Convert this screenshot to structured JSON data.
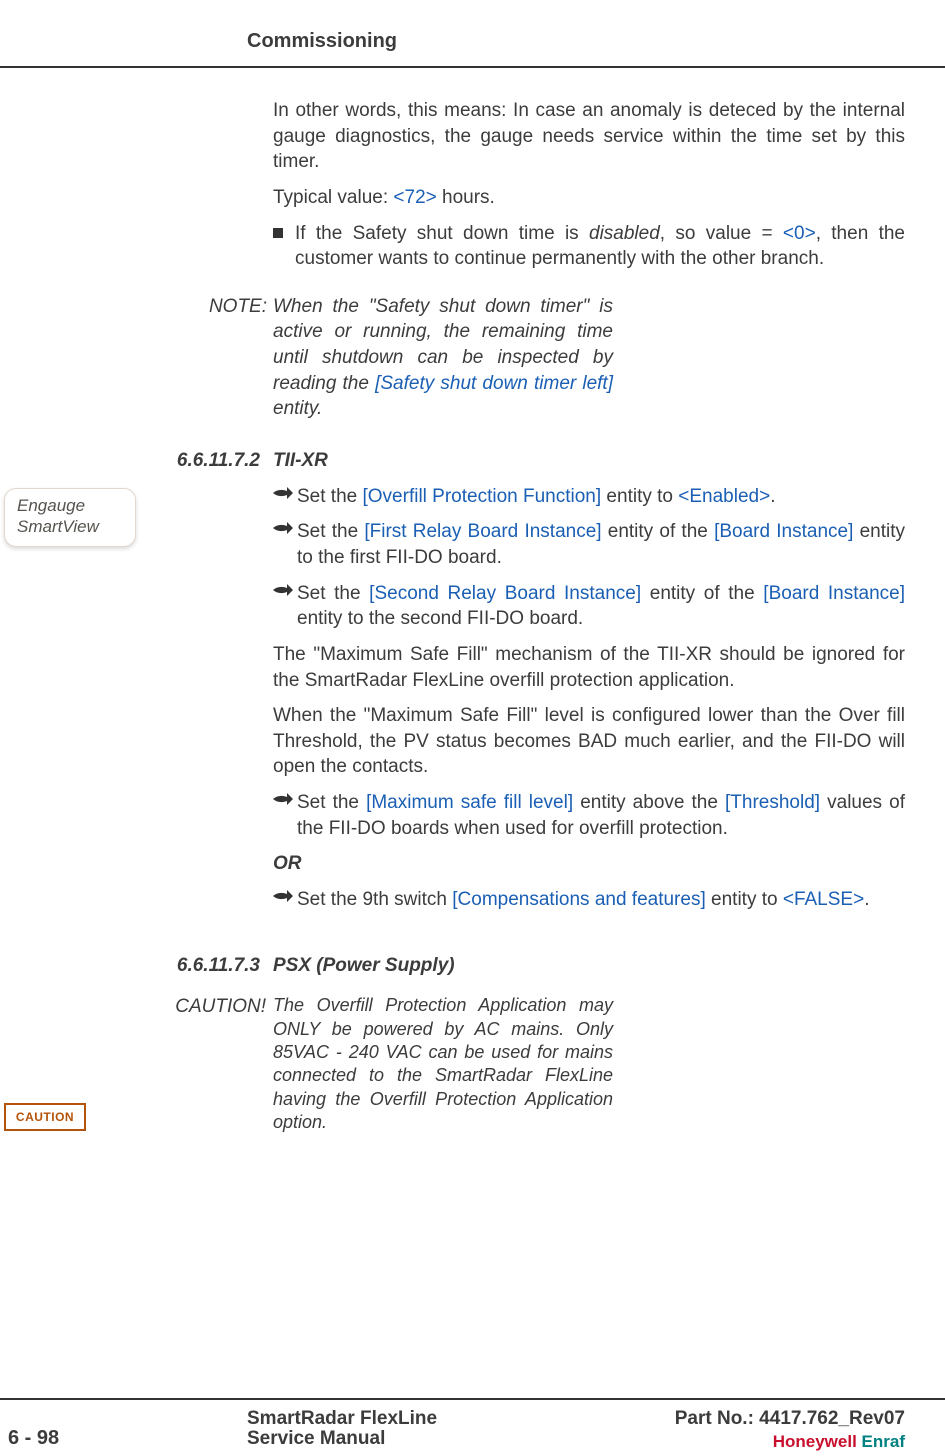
{
  "header": {
    "title": "Commissioning"
  },
  "intro": {
    "p1": "In other words, this means: In case an anomaly is deteced by the internal gauge diagnostics, the gauge  needs service within the time set by this timer.",
    "p2_pre": "Typical value: ",
    "p2_val": "<72>",
    "p2_post": " hours.",
    "bullet_pre": "If the Safety shut down time is ",
    "bullet_em": "disabled",
    "bullet_mid": ", so value = ",
    "bullet_val": "<0>",
    "bullet_post": ", then the customer wants to continue permanently with the other branch."
  },
  "note": {
    "label": "NOTE:",
    "pre": "When the \"Safety shut down timer\" is active or running, the remaining time until shutdown can be inspected by reading the ",
    "entity": "[Safety shut down timer left]",
    "post": " entity."
  },
  "sec1": {
    "num": "6.6.11.7.2",
    "title": "TII-XR",
    "b1_pre": "Set the ",
    "b1_e1": "[Overfill Protection Function]",
    "b1_mid": " entity to ",
    "b1_e2": "<Enabled>",
    "b1_post": ".",
    "b2_pre": "Set the ",
    "b2_e1": "[First Relay Board Instance]",
    "b2_mid": " entity of the ",
    "b2_e2": "[Board Instance]",
    "b2_post": " entity to the first FII-DO board.",
    "b3_pre": "Set the ",
    "b3_e1": "[Second Relay Board Instance]",
    "b3_mid": " entity of the ",
    "b3_e2": "[Board Instance]",
    "b3_post": " entity to the second FII-DO board.",
    "p1": "The \"Maximum Safe Fill\" mechanism of the TII-XR should be ignored for the SmartRadar FlexLine overfill protection application.",
    "p2": "When the \"Maximum Safe Fill\" level is configured lower than the Over fill Threshold, the PV status becomes BAD much earlier, and the FII-DO will open the contacts.",
    "b4_pre": "Set the ",
    "b4_e1": "[Maximum safe fill level]",
    "b4_mid": " entity above the ",
    "b4_e2": "[Threshold]",
    "b4_post": " values of the FII-DO boards when used for overfill protection.",
    "or": "OR",
    "b5_pre": "Set the 9th switch ",
    "b5_e1": "[Compensations and features]",
    "b5_mid": " entity to ",
    "b5_e2": "<FALSE>",
    "b5_post": "."
  },
  "sec2": {
    "num": "6.6.11.7.3",
    "title": "PSX (Power Supply)"
  },
  "caution": {
    "label": "CAUTION!",
    "text": "The Overfill Protection Application may ONLY be powered by AC mains. Only 85VAC - 240 VAC can be used for mains connected to the SmartRadar FlexLine having the Overfill Protection Application option."
  },
  "side_widget": {
    "line1": "Engauge",
    "line2": "SmartView"
  },
  "caution_badge": "CAUTION",
  "footer": {
    "page": "6 - 98",
    "line1": "SmartRadar FlexLine",
    "line2": "Service Manual",
    "partno": "Part No.: 4417.762_Rev07",
    "brand1": "Honeywell",
    "brand2": " Enraf"
  }
}
